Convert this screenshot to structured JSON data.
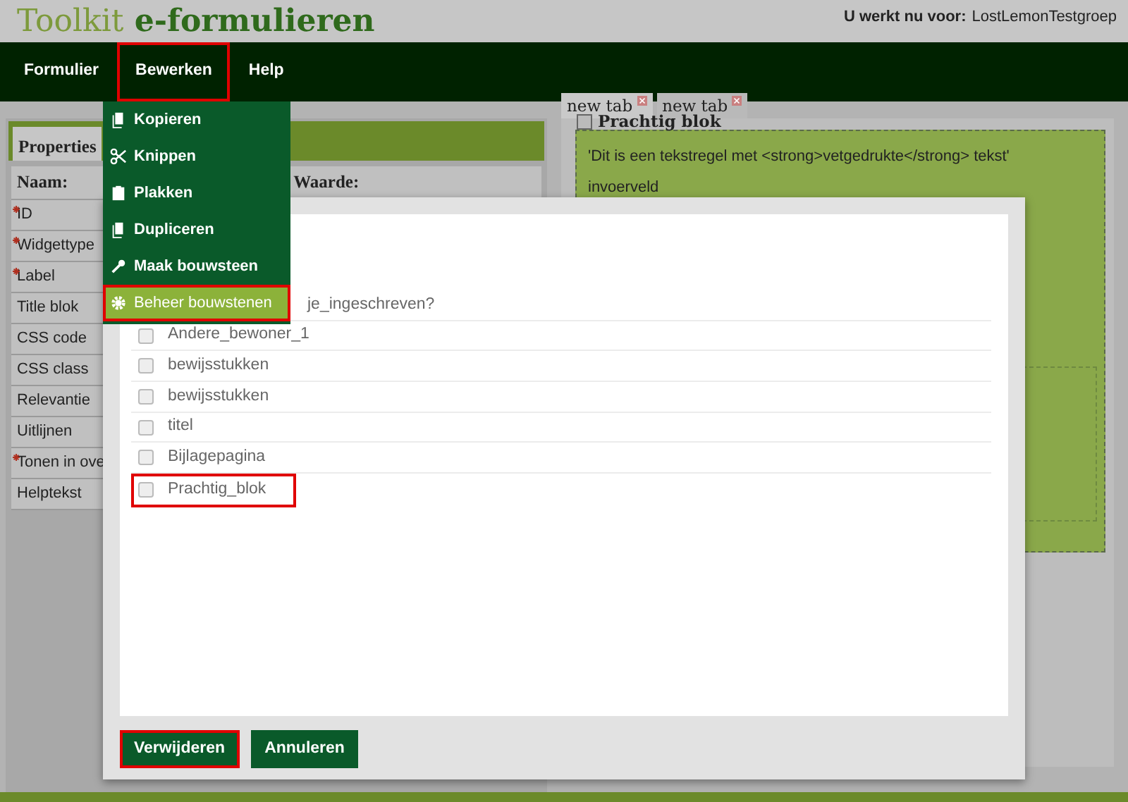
{
  "header": {
    "title_part_1": "Toolkit",
    "title_part_2": "e-formulieren",
    "user_label": "U werkt nu voor:",
    "user_name": "LostLemonTestgroep"
  },
  "nav": [
    {
      "label": "Formulier",
      "highlighted": false
    },
    {
      "label": "Bewerken",
      "highlighted": true
    },
    {
      "label": "Help",
      "highlighted": false
    }
  ],
  "menu": [
    {
      "label": "Kopieren",
      "selected": false,
      "highlighted": false
    },
    {
      "label": "Knippen",
      "selected": false,
      "highlighted": false
    },
    {
      "label": "Plakken",
      "selected": false,
      "highlighted": false
    },
    {
      "label": "Dupliceren",
      "selected": false,
      "highlighted": false
    },
    {
      "label": "Maak bouwsteen",
      "selected": false,
      "highlighted": false
    },
    {
      "label": "Beheer bouwstenen",
      "selected": true,
      "highlighted": true
    }
  ],
  "properties": {
    "tab": "Properties",
    "columns": [
      "Naam:",
      "Waarde:"
    ],
    "rows": [
      {
        "name": "ID",
        "required": true
      },
      {
        "name": "Widgettype",
        "required": true
      },
      {
        "name": "Label",
        "required": true
      },
      {
        "name": "Title blok",
        "required": false
      },
      {
        "name": "CSS code",
        "required": false
      },
      {
        "name": "CSS class",
        "required": false
      },
      {
        "name": "Relevantie",
        "required": false
      },
      {
        "name": "Uitlijnen",
        "required": false
      },
      {
        "name": "Tonen in ove",
        "required": true
      },
      {
        "name": "Helptekst",
        "required": false
      }
    ]
  },
  "editor": {
    "tabs": [
      {
        "label": "new tab",
        "selected": true
      },
      {
        "label": "new tab",
        "selected": false
      }
    ],
    "block": {
      "title": "Prachtig blok",
      "text": "'Dit is een tekstregel met <strong>vetgedrukte</strong> tekst'",
      "field_label": "invoerveld"
    }
  },
  "dialog": {
    "items": [
      {
        "kind": "partial",
        "label": "je_ingeschreven?",
        "highlighted": false
      },
      {
        "kind": "checkbox",
        "label": "Andere_bewoner_1",
        "checked": false,
        "highlighted": false
      },
      {
        "kind": "checkbox",
        "label": "bewijsstukken",
        "checked": false,
        "highlighted": false
      },
      {
        "kind": "checkbox",
        "label": "bewijsstukken",
        "checked": false,
        "highlighted": false
      },
      {
        "kind": "checkbox",
        "label": "titel",
        "checked": false,
        "highlighted": false
      },
      {
        "kind": "checkbox",
        "label": "Bijlagepagina",
        "checked": false,
        "highlighted": false
      },
      {
        "kind": "checkbox",
        "label": "Prachtig_blok",
        "checked": false,
        "highlighted": true
      }
    ],
    "buttons": [
      {
        "label": "Verwijderen",
        "highlighted": true
      },
      {
        "label": "Annuleren",
        "highlighted": false
      }
    ]
  }
}
